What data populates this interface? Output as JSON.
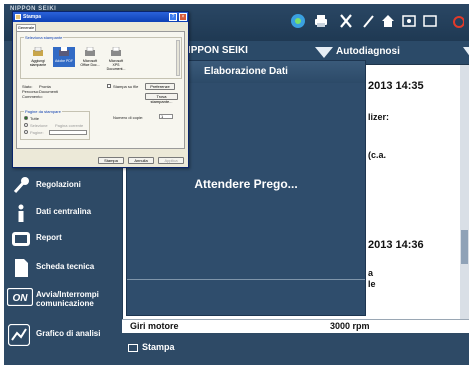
{
  "app": {
    "brand": "NIPPON SEIKI",
    "ecu_title": "RUSCOTTO NIPPON SEIKI",
    "mode_label": "Autodiagnosi"
  },
  "toolbar_icons": [
    "bluetooth-icon",
    "printer-icon",
    "tools-icon",
    "pen-icon",
    "home-icon",
    "monitor-icon",
    "window-icon",
    "power-icon"
  ],
  "sidebar": {
    "items": [
      {
        "label": "Regolazioni",
        "icon": "wrench-icon"
      },
      {
        "label": "Dati centralina",
        "icon": "info-icon"
      },
      {
        "label": "Report",
        "icon": "report-icon"
      },
      {
        "label": "Scheda tecnica",
        "icon": "document-icon"
      },
      {
        "label": "Avvia/Interrompi comunicazione",
        "label_line1": "Avvia/Interrompi",
        "label_line2": "comunicazione",
        "icon": "on-icon"
      },
      {
        "label": "Grafico di analisi",
        "icon": "chart-icon"
      }
    ]
  },
  "report": {
    "date1": "2013 14:35",
    "line_a": "lizer:",
    "line_b": "(c.a.",
    "date2": "2013 14:36",
    "line_c": "a",
    "line_d": "le"
  },
  "rpm": {
    "name": "Giri motore",
    "value": "3000 rpm"
  },
  "print_label": "Stampa",
  "overlay": {
    "title": "Elaborazione Dati",
    "message": "Attendere Prego..."
  },
  "dialog": {
    "title": "Stampa",
    "tab": "Generale",
    "group_printers": "Seleziona stampante",
    "printers": [
      {
        "name": "Aggiungi stampante"
      },
      {
        "name": "Adobe PDF"
      },
      {
        "name": "Microsoft Office Doc..."
      },
      {
        "name": "Microsoft XPS Document..."
      }
    ],
    "status_label": "Stato:",
    "status_value": "Pronta",
    "location_label": "Percorso:",
    "location_value": "Documenti",
    "comment_label": "Commento:",
    "print_to_file": "Stampa su file",
    "preferences_button": "Preferenze",
    "find_printer_button": "Trova stampante...",
    "group_range": "Pagine da stampare",
    "range_all": "Tutte",
    "range_selection": "Selezione",
    "range_current": "Pagina corrente",
    "range_pages": "Pagine:",
    "copies_label": "Numero di copie:",
    "copies_value": "1",
    "print_button": "Stampa",
    "cancel_button": "Annulla",
    "apply_button": "Applica"
  },
  "colors": {
    "app_background": "#2f4a63",
    "title_bar": "#0d40b5",
    "overlay": "#2f4d6c"
  }
}
